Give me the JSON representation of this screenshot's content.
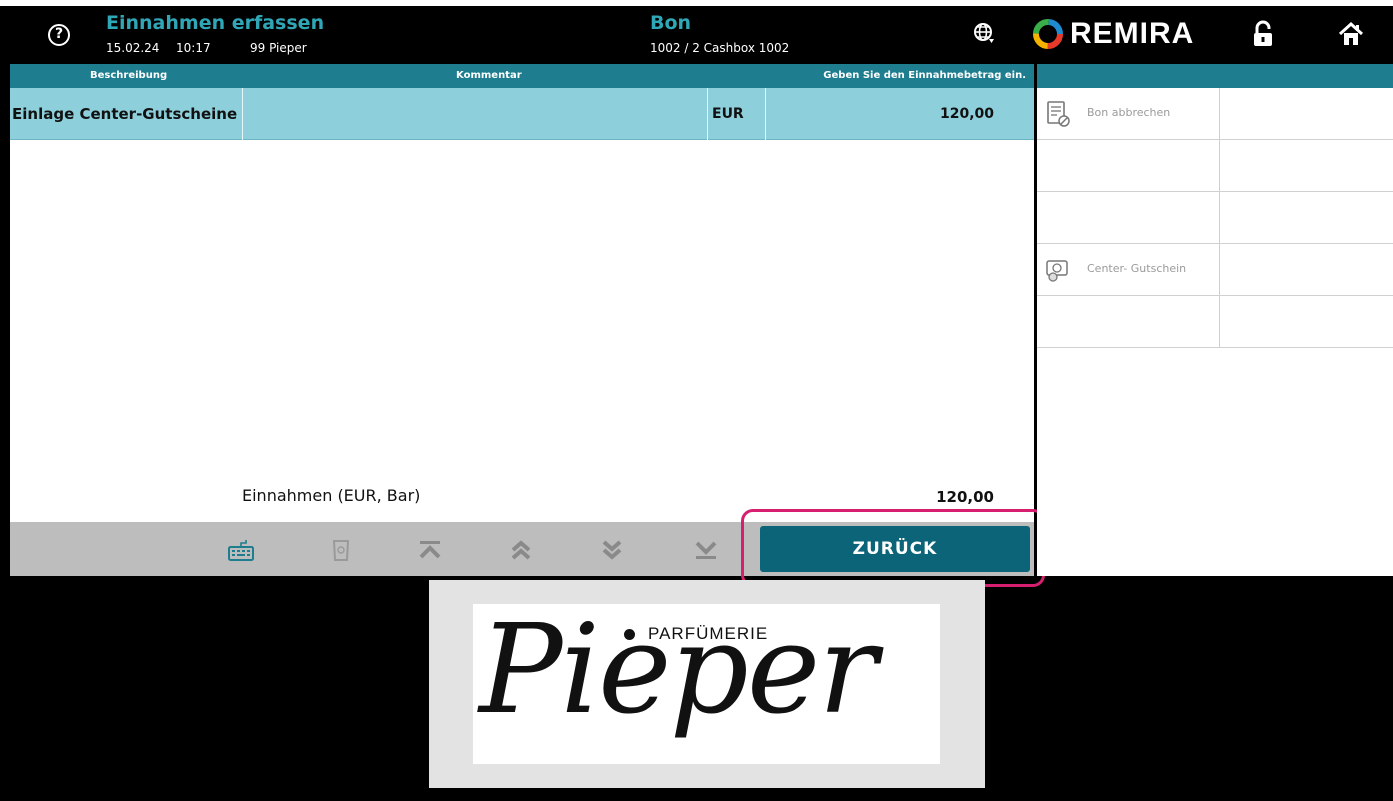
{
  "header": {
    "title": "Einnahmen erfassen",
    "date": "15.02.24",
    "time": "10:17",
    "user": "99 Pieper",
    "bon_title": "Bon",
    "bon_subtitle": "1002 / 2 Cashbox 1002",
    "brand": "REMIRA"
  },
  "table": {
    "columns": [
      "Beschreibung",
      "Kommentar",
      "Geben Sie den Einnahmebetrag ein."
    ],
    "rows": [
      {
        "beschreibung": "Einlage Center-Gutscheine",
        "kommentar": "",
        "currency": "EUR",
        "amount": "120,00"
      }
    ],
    "summary_label": "Einnahmen (EUR, Bar)",
    "summary_value": "120,00"
  },
  "toolbar": {
    "icons": [
      "keyboard-icon",
      "delete-icon",
      "first-page-icon",
      "page-up-icon",
      "page-down-icon",
      "last-page-icon"
    ],
    "back_button": "ZURÜCK"
  },
  "side": {
    "buttons": [
      {
        "label": "Bon abbrechen",
        "icon": "cancel-receipt-icon"
      },
      {
        "label": "",
        "icon": ""
      },
      {
        "label": "",
        "icon": ""
      },
      {
        "label": "Center- Gutschein",
        "icon": "voucher-icon"
      },
      {
        "label": "",
        "icon": ""
      }
    ]
  },
  "logo": {
    "parfumerie": "PARFÜMERIE",
    "script": "Pieper"
  },
  "colors": {
    "accent": "#2fa7b6",
    "header_bar": "#1e7d8e",
    "selected_row": "#8dd0dc",
    "button": "#0b6477",
    "highlight": "#d6206f"
  }
}
